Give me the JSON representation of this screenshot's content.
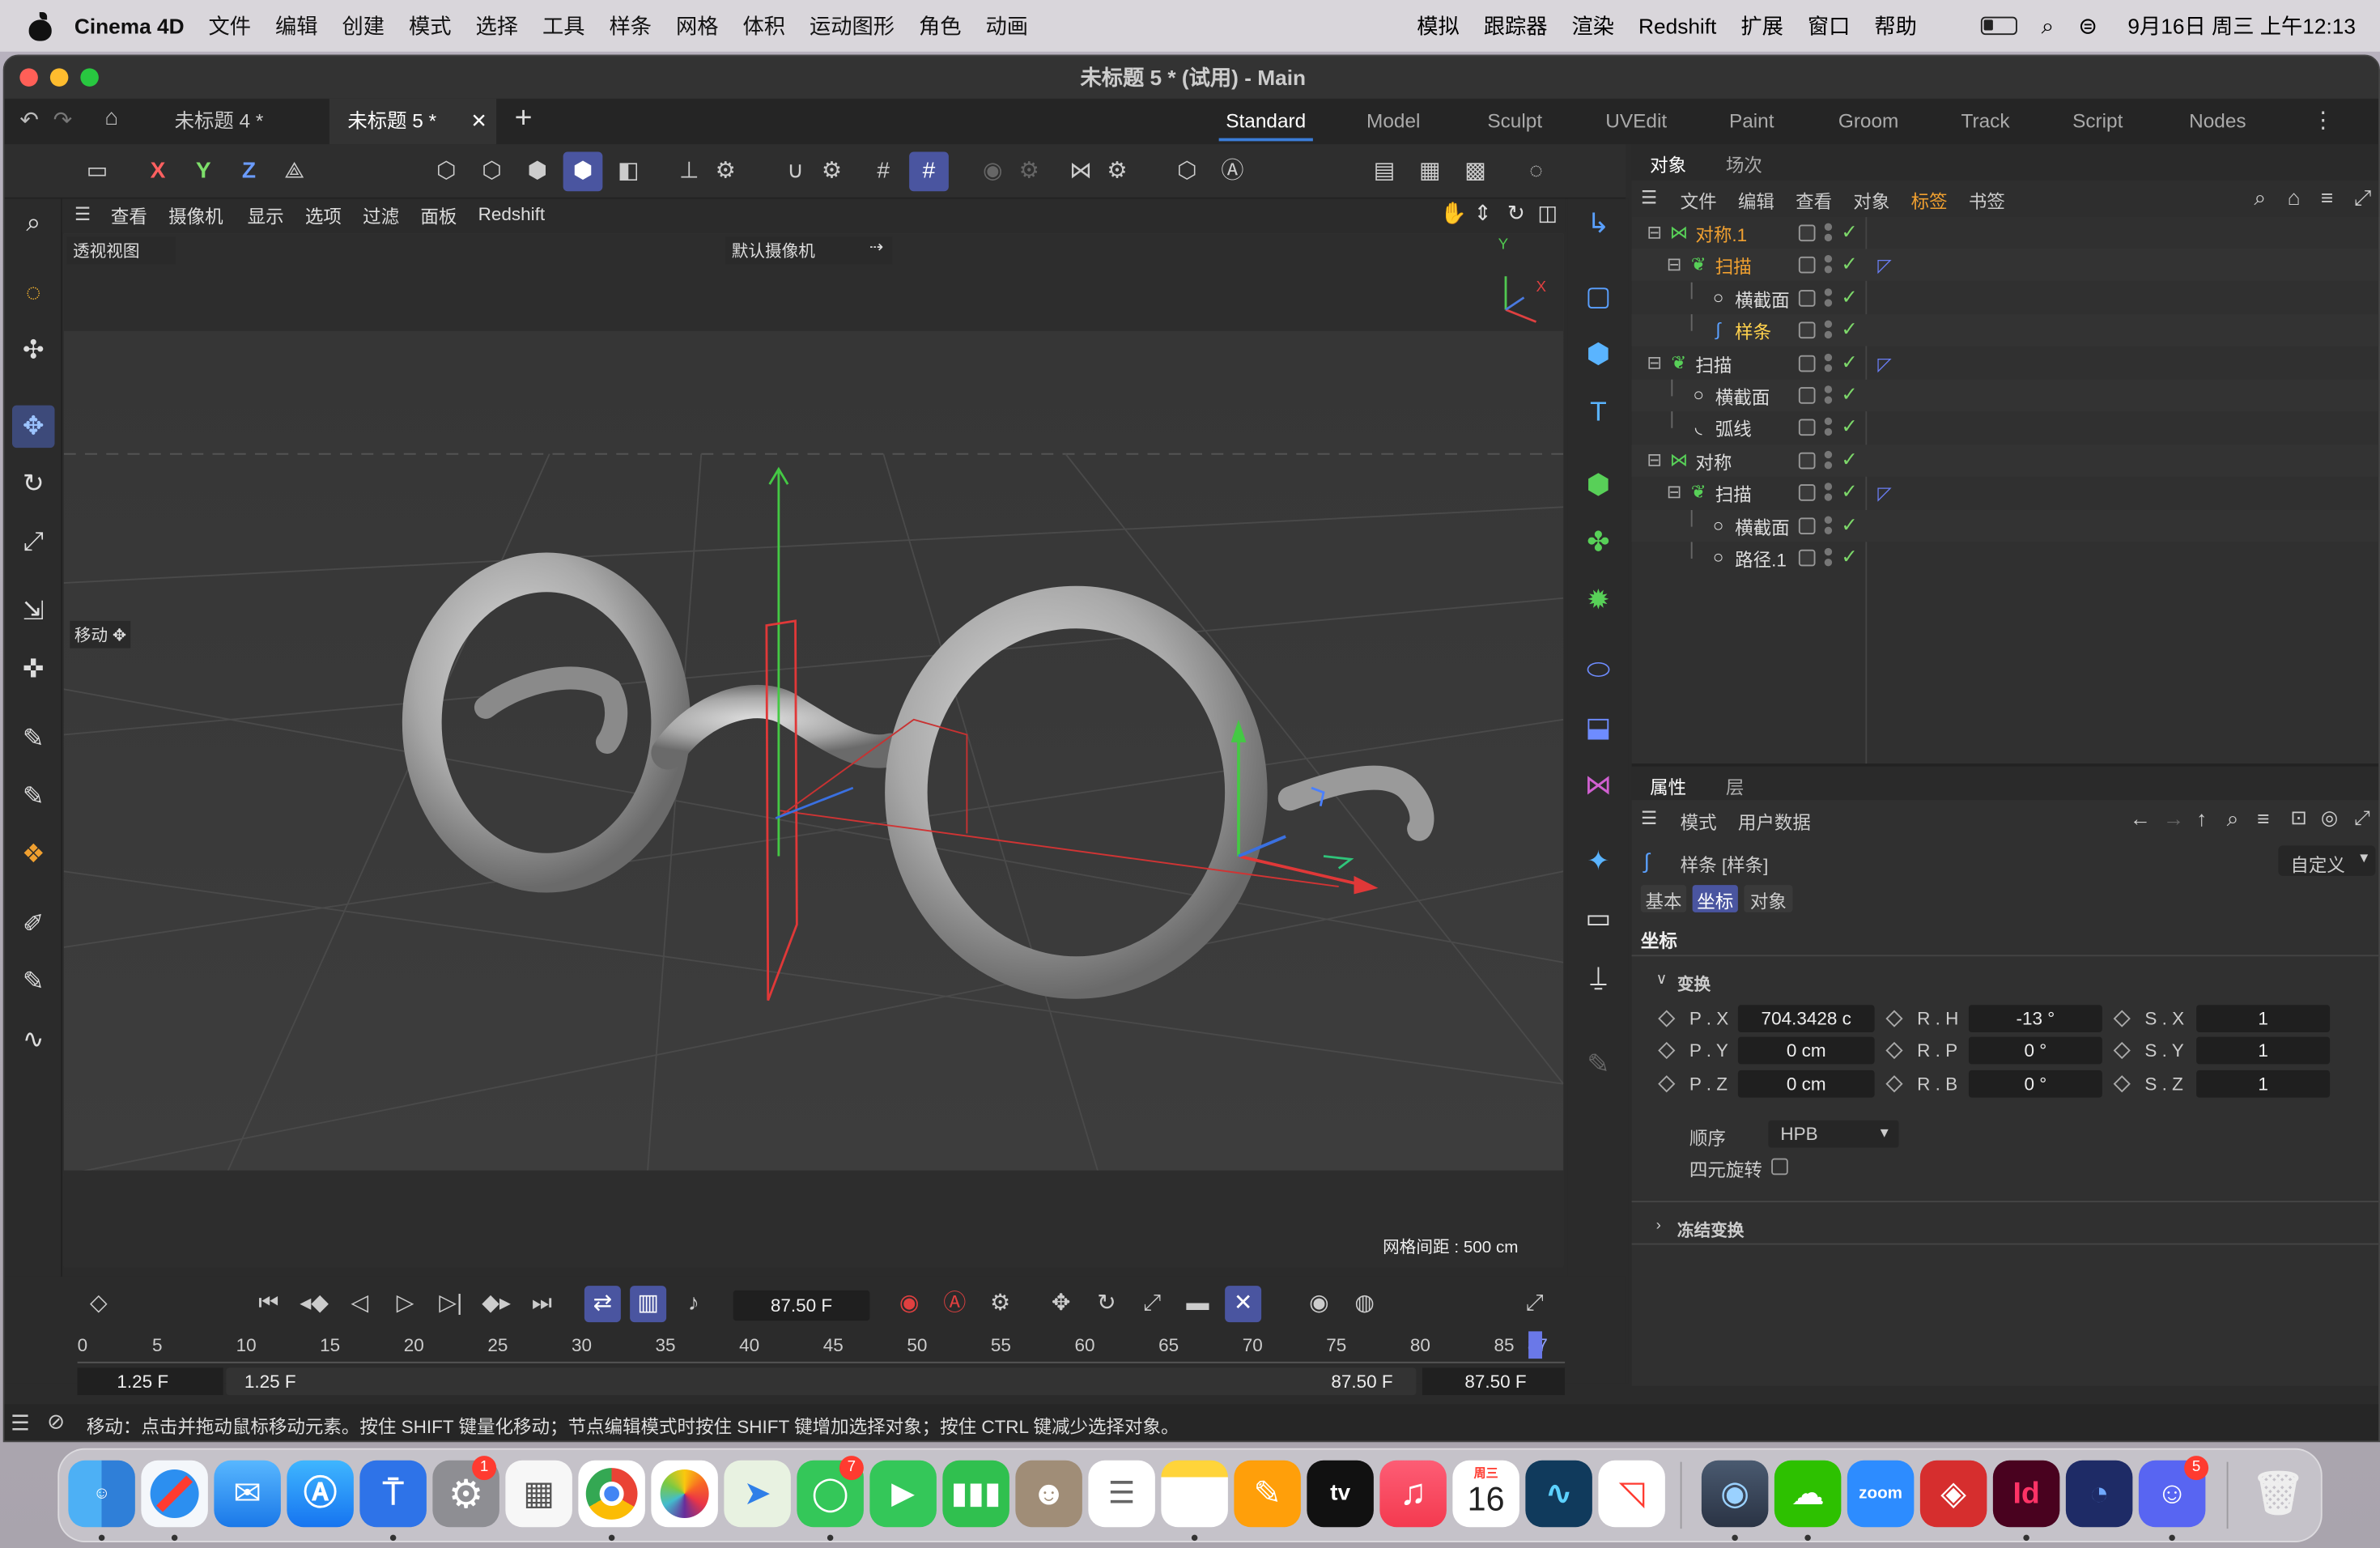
{
  "menubar": {
    "app_name": "Cinema 4D",
    "items": [
      "文件",
      "编辑",
      "创建",
      "模式",
      "选择",
      "工具",
      "样条",
      "网格",
      "体积",
      "运动图形",
      "角色",
      "动画"
    ],
    "right_items": [
      "模拟",
      "跟踪器",
      "渲染",
      "Redshift",
      "扩展",
      "窗口",
      "帮助"
    ],
    "datetime": "9月16日 周三 上午12:13"
  },
  "window": {
    "title": "未标题 5 * (试用) - Main",
    "doc_tabs": [
      "未标题 4 *",
      "未标题 5 *"
    ],
    "workspaces": [
      "Standard",
      "Model",
      "Sculpt",
      "UVEdit",
      "Paint",
      "Groom",
      "Track",
      "Script",
      "Nodes"
    ],
    "active_workspace": "Standard"
  },
  "toolbar": {
    "axis_x": "X",
    "axis_y": "Y",
    "axis_z": "Z"
  },
  "viewport": {
    "menu": [
      "查看",
      "摄像机",
      "显示",
      "选项",
      "过滤",
      "面板",
      "Redshift"
    ],
    "view_name": "透视视图",
    "camera": "默认摄像机",
    "tool_label": "移动",
    "grid_info": "网格间距 : 500 cm",
    "axis_y": "Y",
    "axis_x": "X"
  },
  "objects": {
    "tabs": [
      "对象",
      "场次"
    ],
    "menu": [
      "文件",
      "编辑",
      "查看",
      "对象",
      "标签",
      "书签"
    ],
    "rows": [
      {
        "name": "对称.1",
        "depth": 0,
        "icon": "symmetry-icon",
        "selected": true,
        "tag": false
      },
      {
        "name": "扫描",
        "depth": 1,
        "icon": "sweep-icon",
        "selected": true,
        "tag": true
      },
      {
        "name": "横截面",
        "depth": 2,
        "icon": "circle-icon",
        "selected": false,
        "tag": false
      },
      {
        "name": "样条",
        "depth": 2,
        "icon": "spline-icon",
        "selected": false,
        "highlight": true,
        "tag": false
      },
      {
        "name": "扫描",
        "depth": 0,
        "icon": "sweep-icon",
        "selected": false,
        "tag": true
      },
      {
        "name": "横截面",
        "depth": 1,
        "icon": "circle-icon",
        "selected": false,
        "tag": false
      },
      {
        "name": "弧线",
        "depth": 1,
        "icon": "arc-icon",
        "selected": false,
        "tag": false
      },
      {
        "name": "对称",
        "depth": 0,
        "icon": "symmetry-icon",
        "selected": false,
        "tag": false
      },
      {
        "name": "扫描",
        "depth": 1,
        "icon": "sweep-icon",
        "selected": false,
        "tag": true
      },
      {
        "name": "横截面",
        "depth": 2,
        "icon": "circle-icon",
        "selected": false,
        "tag": false
      },
      {
        "name": "路径.1",
        "depth": 2,
        "icon": "circle-icon",
        "selected": false,
        "tag": false
      }
    ]
  },
  "attributes": {
    "tabs": [
      "属性",
      "层"
    ],
    "menu": [
      "模式",
      "用户数据"
    ],
    "object_title": "样条 [样条]",
    "preset": "自定义",
    "sub_tabs": [
      "基本",
      "坐标",
      "对象"
    ],
    "active_sub_tab": "坐标",
    "section": "坐标",
    "group": "变换",
    "fields": {
      "px_label": "P . X",
      "px": "704.3428 c",
      "py_label": "P . Y",
      "py": "0 cm",
      "pz_label": "P . Z",
      "pz": "0 cm",
      "rh_label": "R . H",
      "rh": "-13 °",
      "rp_label": "R . P",
      "rp": "0 °",
      "rb_label": "R . B",
      "rb": "0 °",
      "sx_label": "S . X",
      "sx": "1",
      "sy_label": "S . Y",
      "sy": "1",
      "sz_label": "S . Z",
      "sz": "1"
    },
    "order_label": "顺序",
    "order_value": "HPB",
    "quat_label": "四元旋转",
    "freeze_label": "冻结变换"
  },
  "timeline": {
    "current_frame": "87.50 F",
    "ticks": [
      "0",
      "5",
      "10",
      "15",
      "20",
      "25",
      "30",
      "35",
      "40",
      "45",
      "50",
      "55",
      "60",
      "65",
      "70",
      "75",
      "80",
      "85",
      "87"
    ],
    "range_start": "1.25 F",
    "range_start2": "1.25 F",
    "range_end": "87.50 F",
    "range_end2": "87.50 F"
  },
  "status": {
    "text": "移动：点击并拖动鼠标移动元素。按住 SHIFT 键量化移动；节点编辑模式时按住 SHIFT 键增加选择对象；按住 CTRL 键减少选择对象。"
  },
  "dock": {
    "calendar_weekday": "周三",
    "calendar_day": "16",
    "settings_badge": "1",
    "messages_badge": "7",
    "discord_badge": "5",
    "zoom_label": "zoom",
    "indesign_label": "Id",
    "tv_label": "tv"
  }
}
